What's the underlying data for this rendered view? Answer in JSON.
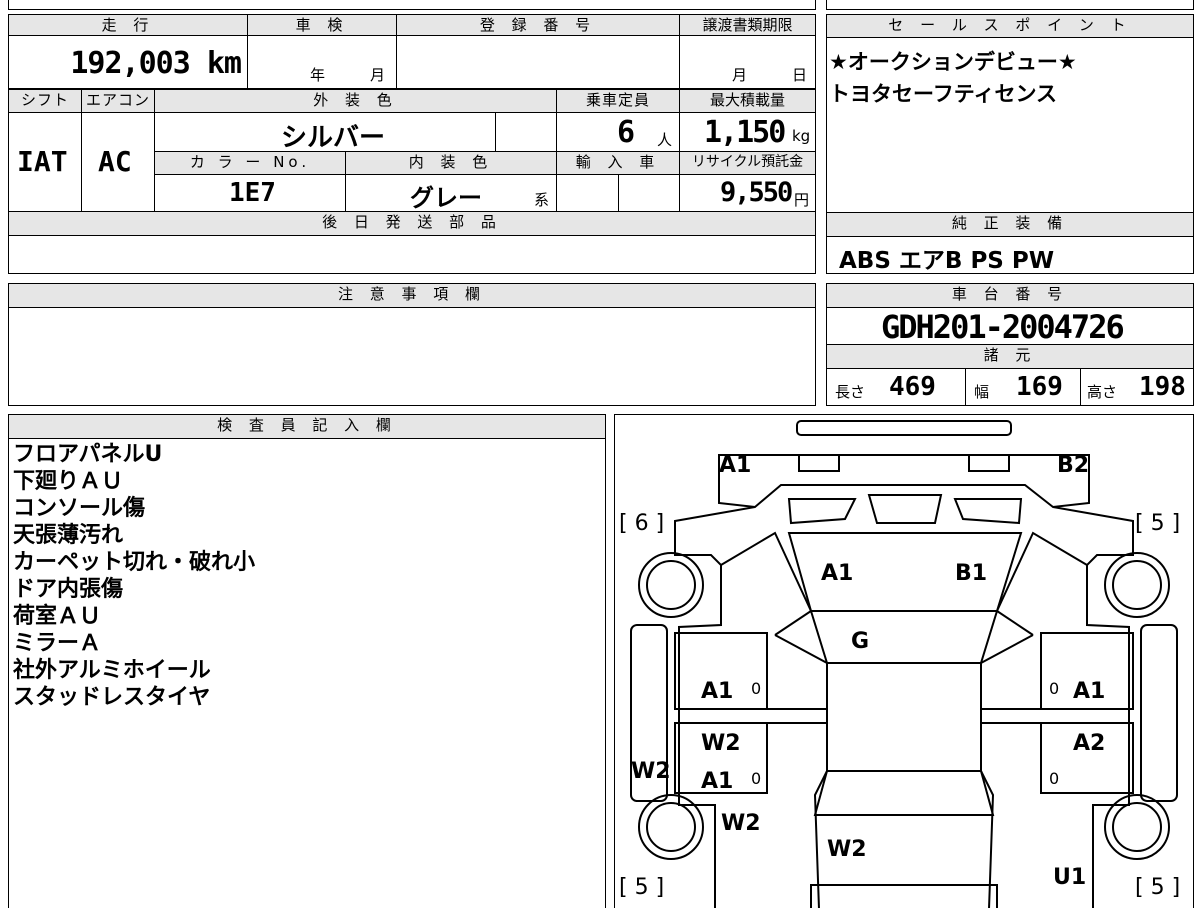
{
  "vehicle": {
    "mileage_label": "走 行",
    "mileage": "192,003 km",
    "shaken_label": "車 検",
    "shaken_year": "年",
    "shaken_month": "月",
    "registration_label": "登 録 番 号",
    "transfer_label": "譲渡書類期限",
    "transfer_month": "月",
    "transfer_day": "日",
    "shift_label": "シフト",
    "shift": "IAT",
    "ac_label": "エアコン",
    "ac": "AC",
    "exterior_label": "外 装 色",
    "exterior": "シルバー",
    "capacity_label": "乗車定員",
    "capacity": "6",
    "capacity_unit": "人",
    "max_load_label": "最大積載量",
    "max_load": "1,150",
    "max_load_unit": "kg",
    "color_no_label": "カ ラ ー No.",
    "color_no": "1E7",
    "interior_label": "内 装 色",
    "interior": "グレー",
    "interior_suffix": "系",
    "import_label": "輸 入 車",
    "recycle_label": "リサイクル預託金",
    "recycle": "9,550",
    "recycle_unit": "円",
    "later_parts_label": "後 日 発 送 部 品",
    "notes_label": "注 意 事 項 欄",
    "inspector_label": "検 査 員 記 入 欄"
  },
  "sales_points": {
    "label": "セ ー ル ス ポ イ ン ト",
    "lines": [
      "★オークションデビュー★",
      "トヨタセーフティセンス"
    ]
  },
  "equipment": {
    "label": "純 正 装 備",
    "value": "ABS エアB PS PW"
  },
  "chassis": {
    "label": "車 台 番 号",
    "value": "GDH201-2004726"
  },
  "specs": {
    "label": "諸 元",
    "length_label": "長さ",
    "length": "469",
    "width_label": "幅",
    "width": "169",
    "height_label": "高さ",
    "height": "198"
  },
  "inspector_notes": [
    "フロアパネルU",
    "下廻りＡＵ",
    "コンソール傷",
    "天張薄汚れ",
    "カーペット切れ・破れ小",
    "ドア内張傷",
    "荷室ＡＵ",
    "ミラーＡ",
    "社外アルミホイール",
    "スタッドレスタイヤ"
  ],
  "diagram": {
    "tire_fl": "[ 6 ]",
    "tire_fr": "[ 5 ]",
    "tire_rl": "[ 5 ]",
    "tire_rr": "[ 5 ]",
    "hood_left": "A1",
    "hood_right": "B2",
    "windshield_left": "A1",
    "windshield_right": "B1",
    "roof": "G",
    "left_front_door": "A1",
    "left_mid": "W2",
    "left_rear_door": "A1",
    "left_side": "W2",
    "left_lower": "W2",
    "right_front_door": "A1",
    "right_rear_door": "A2",
    "rear_center": "W2",
    "rear_right": "U1",
    "zero_1": "0",
    "zero_2": "0",
    "zero_3": "0",
    "zero_4": "0"
  },
  "colors": {
    "header_bg": "#e6e6e6",
    "border": "#000000"
  }
}
